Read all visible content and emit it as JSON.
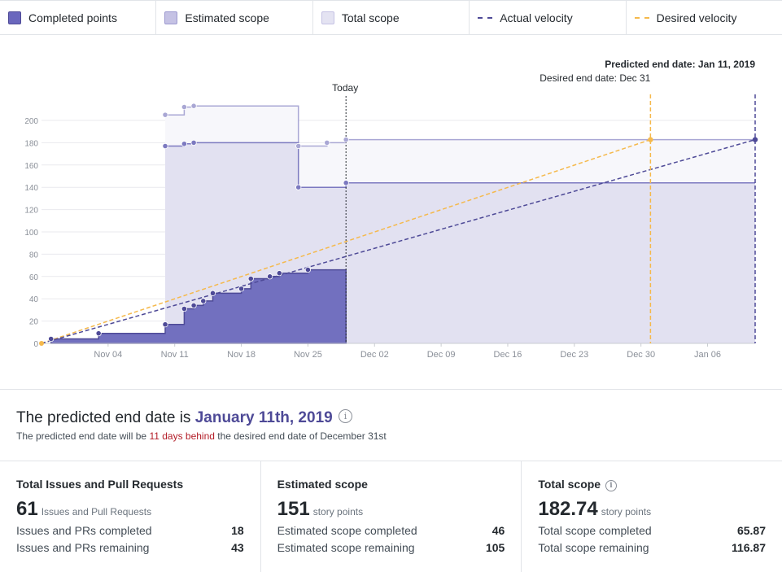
{
  "legend": [
    {
      "name": "legend-completed-points",
      "label": "Completed points",
      "kind": "box",
      "fill": "#6a67bd",
      "stroke": "#4e4a97"
    },
    {
      "name": "legend-estimated-scope",
      "label": "Estimated scope",
      "kind": "box",
      "fill": "#c5c2e4",
      "stroke": "#9d9ad0"
    },
    {
      "name": "legend-total-scope",
      "label": "Total scope",
      "kind": "box",
      "fill": "#e4e3f2",
      "stroke": "#c5c2e4"
    },
    {
      "name": "legend-actual-velocity",
      "label": "Actual velocity",
      "kind": "dash",
      "stroke": "#4e4a97"
    },
    {
      "name": "legend-desired-velocity",
      "label": "Desired velocity",
      "kind": "dash",
      "stroke": "#f5b94c"
    }
  ],
  "colors": {
    "completed_fill": "#7270bf",
    "completed_stroke": "#4e4a97",
    "estimated_fill": "#e2e1f1",
    "estimated_stroke": "#7c79c0",
    "total_fill": "#f7f7fb",
    "total_stroke": "#a9a7d4",
    "actual": "#4e4a97",
    "desired": "#f5b94c",
    "grid": "#e9e9ee",
    "tick": "#8a8f98"
  },
  "chart_data": {
    "type": "area",
    "x_axis": {
      "start": "2018-10-28",
      "end": "2019-01-11",
      "tick_labels": [
        "Nov 04",
        "Nov 11",
        "Nov 18",
        "Nov 25",
        "Dec 02",
        "Dec 09",
        "Dec 16",
        "Dec 23",
        "Dec 30",
        "Jan 06"
      ],
      "tick_dates": [
        "2018-11-04",
        "2018-11-11",
        "2018-11-18",
        "2018-11-25",
        "2018-12-02",
        "2018-12-09",
        "2018-12-16",
        "2018-12-23",
        "2018-12-30",
        "2019-01-06"
      ]
    },
    "y_axis": {
      "ylim": [
        0,
        200
      ],
      "ticks": [
        0,
        20,
        40,
        60,
        80,
        100,
        120,
        140,
        160,
        180,
        200
      ]
    },
    "grid": true,
    "series": [
      {
        "name": "Total scope",
        "points": [
          [
            "2018-11-10",
            0
          ],
          [
            "2018-11-10",
            205
          ],
          [
            "2018-11-12",
            205
          ],
          [
            "2018-11-12",
            212
          ],
          [
            "2018-11-13",
            212
          ],
          [
            "2018-11-13",
            213
          ],
          [
            "2018-11-24",
            213
          ],
          [
            "2018-11-24",
            177
          ],
          [
            "2018-11-27",
            177
          ],
          [
            "2018-11-27",
            180
          ],
          [
            "2018-11-29",
            180
          ],
          [
            "2018-11-29",
            182.74
          ],
          [
            "2019-01-11",
            182.74
          ]
        ]
      },
      {
        "name": "Estimated scope",
        "points": [
          [
            "2018-11-10",
            0
          ],
          [
            "2018-11-10",
            177
          ],
          [
            "2018-11-12",
            177
          ],
          [
            "2018-11-12",
            179
          ],
          [
            "2018-11-13",
            179
          ],
          [
            "2018-11-13",
            180
          ],
          [
            "2018-11-24",
            180
          ],
          [
            "2018-11-24",
            140
          ],
          [
            "2018-11-29",
            140
          ],
          [
            "2018-11-29",
            144
          ],
          [
            "2019-01-11",
            144
          ]
        ]
      },
      {
        "name": "Completed points",
        "points": [
          [
            "2018-10-29",
            0
          ],
          [
            "2018-10-29",
            4
          ],
          [
            "2018-11-03",
            4
          ],
          [
            "2018-11-03",
            9
          ],
          [
            "2018-11-10",
            9
          ],
          [
            "2018-11-10",
            17
          ],
          [
            "2018-11-12",
            17
          ],
          [
            "2018-11-12",
            31
          ],
          [
            "2018-11-13",
            31
          ],
          [
            "2018-11-13",
            34
          ],
          [
            "2018-11-14",
            34
          ],
          [
            "2018-11-14",
            38
          ],
          [
            "2018-11-15",
            38
          ],
          [
            "2018-11-15",
            45
          ],
          [
            "2018-11-18",
            45
          ],
          [
            "2018-11-18",
            49
          ],
          [
            "2018-11-19",
            49
          ],
          [
            "2018-11-19",
            58
          ],
          [
            "2018-11-21",
            58
          ],
          [
            "2018-11-21",
            60
          ],
          [
            "2018-11-22",
            60
          ],
          [
            "2018-11-22",
            63
          ],
          [
            "2018-11-25",
            63
          ],
          [
            "2018-11-25",
            66
          ],
          [
            "2018-11-29",
            66
          ],
          [
            "2018-11-29",
            0
          ]
        ]
      },
      {
        "name": "Completed points markers",
        "points": [
          [
            "2018-10-29",
            4
          ],
          [
            "2018-11-03",
            9
          ],
          [
            "2018-11-10",
            17
          ],
          [
            "2018-11-12",
            31
          ],
          [
            "2018-11-13",
            34
          ],
          [
            "2018-11-14",
            38
          ],
          [
            "2018-11-15",
            45
          ],
          [
            "2018-11-18",
            49
          ],
          [
            "2018-11-19",
            58
          ],
          [
            "2018-11-21",
            60
          ],
          [
            "2018-11-22",
            63
          ],
          [
            "2018-11-25",
            66
          ]
        ]
      },
      {
        "name": "Estimated scope markers",
        "points": [
          [
            "2018-11-10",
            177
          ],
          [
            "2018-11-12",
            179
          ],
          [
            "2018-11-13",
            180
          ],
          [
            "2018-11-24",
            140
          ],
          [
            "2018-11-29",
            144
          ]
        ]
      },
      {
        "name": "Total scope markers",
        "points": [
          [
            "2018-11-10",
            205
          ],
          [
            "2018-11-12",
            212
          ],
          [
            "2018-11-13",
            213
          ],
          [
            "2018-11-24",
            177
          ],
          [
            "2018-11-27",
            180
          ],
          [
            "2018-11-29",
            182.74
          ]
        ]
      },
      {
        "name": "Actual velocity",
        "points": [
          [
            "2018-10-28",
            0
          ],
          [
            "2019-01-11",
            182.74
          ]
        ]
      },
      {
        "name": "Desired velocity",
        "points": [
          [
            "2018-10-28",
            0
          ],
          [
            "2018-12-31",
            182.74
          ]
        ]
      }
    ],
    "annotations": [
      {
        "name": "today",
        "text": "Today",
        "date": "2018-11-29"
      },
      {
        "name": "predicted-end",
        "text": "Predicted end date: Jan 11, 2019",
        "date": "2019-01-11"
      },
      {
        "name": "desired-end",
        "text": "Desired end date: Dec 31",
        "date": "2018-12-31"
      }
    ]
  },
  "prediction": {
    "prefix": "The predicted end date is ",
    "date": "January 11th, 2019",
    "info_glyph": "i",
    "sub_prefix": "The predicted end date will be ",
    "sub_behind": "11 days behind",
    "sub_suffix": " the desired end date of December 31st"
  },
  "stats": {
    "issues": {
      "title": "Total Issues and Pull Requests",
      "big": "61",
      "unit": "Issues and Pull Requests",
      "rows": [
        {
          "label": "Issues and PRs completed",
          "value": "18"
        },
        {
          "label": "Issues and PRs remaining",
          "value": "43"
        }
      ]
    },
    "estimated": {
      "title": "Estimated scope",
      "big": "151",
      "unit": "story points",
      "rows": [
        {
          "label": "Estimated scope completed",
          "value": "46"
        },
        {
          "label": "Estimated scope remaining",
          "value": "105"
        }
      ]
    },
    "total": {
      "title": "Total scope",
      "info_glyph": "i",
      "big": "182.74",
      "unit": "story points",
      "rows": [
        {
          "label": "Total scope completed",
          "value": "65.87"
        },
        {
          "label": "Total scope remaining",
          "value": "116.87"
        }
      ]
    }
  }
}
